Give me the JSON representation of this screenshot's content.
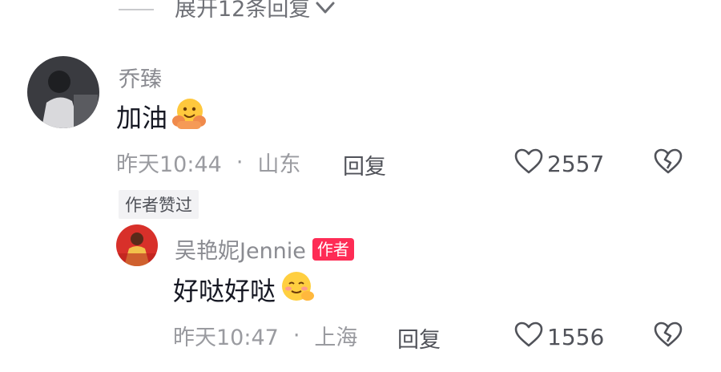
{
  "expand_replies": {
    "label": "展开12条回复",
    "icon": "chevron-down-icon"
  },
  "comment": {
    "username": "乔臻",
    "text": "加油",
    "emoji": "hug-emoji",
    "time": "昨天10:44",
    "separator": "·",
    "location": "山东",
    "reply_label": "回复",
    "like_count": "2557",
    "author_liked_tag": "作者赞过"
  },
  "reply": {
    "username": "吴艳妮Jennie",
    "author_badge": "作者",
    "text": "好哒好哒",
    "emoji": "shy-face-emoji",
    "time": "昨天10:47",
    "separator": "·",
    "location": "上海",
    "reply_label": "回复",
    "like_count": "1556"
  },
  "colors": {
    "accent": "#fe2c55",
    "meta": "#9a9ba0",
    "text": "#161823"
  }
}
